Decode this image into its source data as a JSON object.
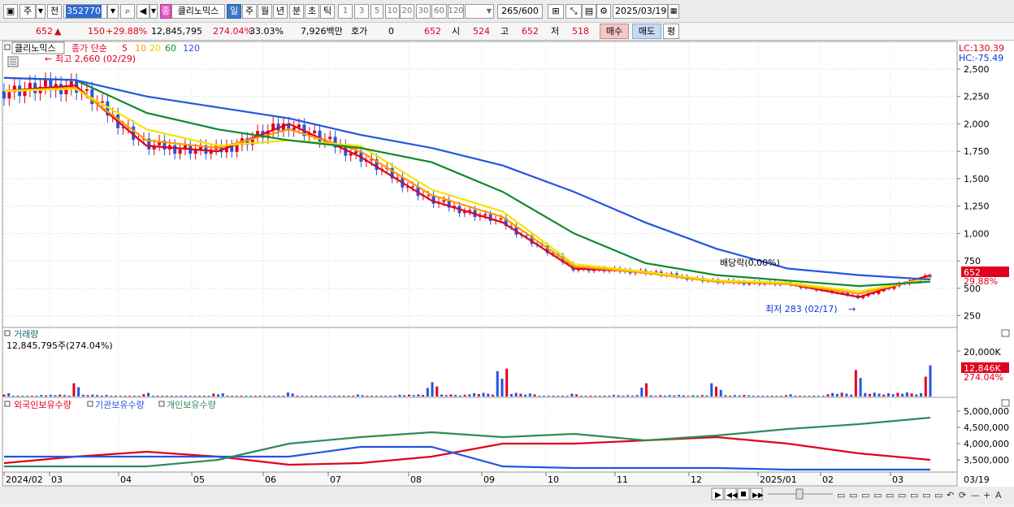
{
  "toolbar": {
    "stock_type": "주",
    "prev_label": "전",
    "stock_code": "352770",
    "stock_badge": "종",
    "stock_name": "클리노믹스",
    "periods": [
      "일",
      "주",
      "월",
      "년",
      "분",
      "초",
      "틱"
    ],
    "active_period": "일",
    "intervals": [
      "1",
      "3",
      "5",
      "10",
      "20",
      "30",
      "60",
      "120"
    ],
    "count_value": "265",
    "count_total": "/600",
    "date_value": "2025/03/19"
  },
  "quote": {
    "price": "652",
    "change": "150",
    "change_pct": "+29.88%",
    "volume": "12,845,795",
    "volume_pct": "274.04%",
    "turnover_pct": "33.03%",
    "amount": "7,926백만",
    "hoga_label": "호가",
    "hoga_value": "0",
    "hoga_price": "652",
    "open_label": "시",
    "open": "524",
    "high_label": "고",
    "high": "652",
    "low_label": "저",
    "low": "518",
    "buy_label": "매수",
    "sell_label": "매도",
    "avg_label": "평"
  },
  "price_panel": {
    "stock_tag": "클리노믹스",
    "ma_title": "종가 단순",
    "ma_periods": [
      "5",
      "10",
      "20",
      "60",
      "120"
    ],
    "ma_colors": [
      "#e1001e",
      "#ff9900",
      "#f3e300",
      "#0e8a2e",
      "#2456e0"
    ],
    "high_annotation": "최고 2,660 (02/29)",
    "low_annotation": "최저 283 (02/17)",
    "dividend_annotation": "배당락(0,00%)",
    "lc": "LC:130.39",
    "hc": "HC:-75.49",
    "y_ticks": [
      "2,500",
      "2,250",
      "2,000",
      "1,750",
      "1,500",
      "1,250",
      "1,000",
      "750",
      "500",
      "250"
    ],
    "current_tag": "652",
    "current_pct_tag": "29.88%"
  },
  "volume_panel": {
    "title": "거래량",
    "value": "12,845,795주(274.04%)",
    "y_tick": "20,000K",
    "current_tag": "12,846K",
    "current_pct_tag": "274.04%"
  },
  "holdings_panel": {
    "legend": [
      {
        "label": "외국인보유수량",
        "color": "#e1001e"
      },
      {
        "label": "기관보유수량",
        "color": "#2456e0"
      },
      {
        "label": "개인보유수량",
        "color": "#2e8b57"
      }
    ],
    "y_ticks": [
      "5,000,000",
      "4,500,000",
      "4,000,000",
      "3,500,000"
    ]
  },
  "x_axis": {
    "labels": [
      "2024/02",
      "03",
      "04",
      "05",
      "06",
      "07",
      "08",
      "09",
      "10",
      "11",
      "12",
      "2025/01",
      "02",
      "03"
    ],
    "right_label": "03/19"
  },
  "chart_data": [
    {
      "type": "line",
      "title": "클리노믹스 종가 단순 5 10 20 60 120",
      "x": [
        "2024/02",
        "03",
        "04",
        "05",
        "06",
        "07",
        "08",
        "09",
        "10",
        "11",
        "12",
        "2025/01",
        "02",
        "03"
      ],
      "series": [
        {
          "name": "5",
          "values": [
            2300,
            2350,
            1800,
            1750,
            2000,
            1700,
            1300,
            1100,
            680,
            650,
            560,
            540,
            420,
            620
          ]
        },
        {
          "name": "10",
          "values": [
            2300,
            2330,
            1850,
            1780,
            1950,
            1750,
            1350,
            1150,
            700,
            640,
            560,
            540,
            450,
            600
          ]
        },
        {
          "name": "20",
          "values": [
            2300,
            2320,
            1950,
            1800,
            1850,
            1800,
            1400,
            1200,
            720,
            650,
            570,
            550,
            470,
            590
          ]
        },
        {
          "name": "60",
          "values": [
            2420,
            2400,
            2100,
            1950,
            1850,
            1780,
            1650,
            1380,
            1000,
            730,
            620,
            570,
            520,
            560
          ]
        },
        {
          "name": "120",
          "values": [
            2420,
            2400,
            2250,
            2150,
            2050,
            1900,
            1780,
            1620,
            1380,
            1100,
            860,
            680,
            620,
            580
          ]
        }
      ],
      "annotations": [
        "최고 2,660 (02/29)",
        "최저 283 (02/17)",
        "배당락(0,00%)"
      ],
      "ylim": [
        150,
        2700
      ],
      "grid": true
    },
    {
      "type": "bar",
      "title": "거래량",
      "categories": [
        "2024/02",
        "03",
        "04",
        "05",
        "06",
        "07",
        "08",
        "09",
        "10",
        "11",
        "12",
        "2025/01",
        "02",
        "03"
      ],
      "values": [
        1500,
        6000,
        1500,
        1200,
        1500,
        1000,
        6500,
        11500,
        1200,
        5000,
        5000,
        1000,
        12000,
        12846
      ],
      "ylim": [
        0,
        28000
      ]
    },
    {
      "type": "line",
      "title": "외국인보유수량 기관보유수량 개인보유수량",
      "x": [
        "2024/02",
        "03",
        "04",
        "05",
        "06",
        "07",
        "08",
        "09",
        "10",
        "11",
        "12",
        "2025/01",
        "02",
        "03"
      ],
      "series": [
        {
          "name": "외국인보유수량",
          "values": [
            3400000,
            3600000,
            3750000,
            3600000,
            3350000,
            3400000,
            3600000,
            4000000,
            4000000,
            4100000,
            4200000,
            4000000,
            3700000,
            3500000
          ]
        },
        {
          "name": "기관보유수량",
          "values": [
            3600000,
            3600000,
            3600000,
            3600000,
            3600000,
            3900000,
            3900000,
            3300000,
            3250000,
            3250000,
            3250000,
            3200000,
            3200000,
            3200000
          ]
        },
        {
          "name": "개인보유수량",
          "values": [
            3300000,
            3300000,
            3300000,
            3500000,
            4000000,
            4200000,
            4350000,
            4200000,
            4300000,
            4100000,
            4250000,
            4450000,
            4600000,
            4800000
          ]
        }
      ],
      "ylim": [
        3200000,
        5100000
      ]
    }
  ]
}
